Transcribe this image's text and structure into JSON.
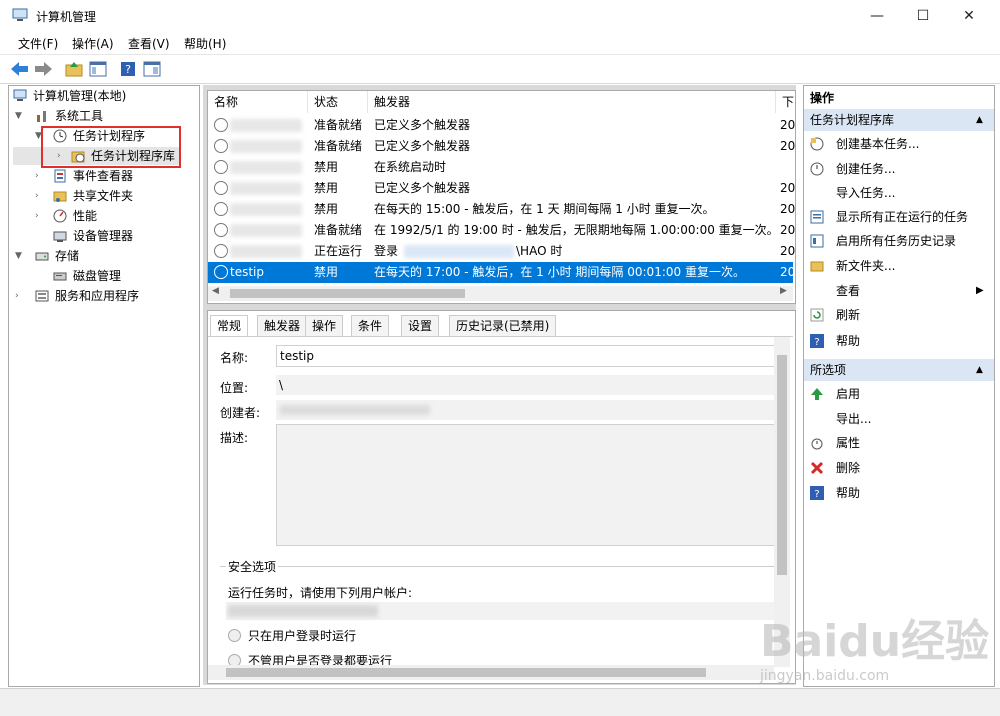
{
  "window": {
    "title": "计算机管理"
  },
  "menu": [
    "文件(F)",
    "操作(A)",
    "查看(V)",
    "帮助(H)"
  ],
  "tree": {
    "root": "计算机管理(本地)",
    "system_tools": "系统工具",
    "task_scheduler": "任务计划程序",
    "task_library": "任务计划程序库",
    "event_viewer": "事件查看器",
    "shared_folders": "共享文件夹",
    "performance": "性能",
    "device_manager": "设备管理器",
    "storage": "存储",
    "disk_management": "磁盘管理",
    "services_apps": "服务和应用程序"
  },
  "list": {
    "columns": [
      "名称",
      "状态",
      "触发器",
      "下"
    ],
    "rows": [
      {
        "name": "",
        "status": "准备就绪",
        "trigger": "已定义多个触发器",
        "next": "20"
      },
      {
        "name": "",
        "status": "准备就绪",
        "trigger": "已定义多个触发器",
        "next": "20"
      },
      {
        "name": "",
        "status": "禁用",
        "trigger": "在系统启动时",
        "next": ""
      },
      {
        "name": "",
        "status": "禁用",
        "trigger": "已定义多个触发器",
        "next": "20"
      },
      {
        "name": "",
        "status": "禁用",
        "trigger": "在每天的 15:00 - 触发后，在 1 天 期间每隔 1 小时 重复一次。",
        "next": "20"
      },
      {
        "name": "",
        "status": "准备就绪",
        "trigger": "在 1992/5/1 的 19:00 时 - 触发后，无限期地每隔 1.00:00:00 重复一次。",
        "next": "20"
      },
      {
        "name": "",
        "status": "正在运行",
        "trigger": "登录",
        "trigger_tail": "\\HAO 时",
        "next": "20"
      },
      {
        "name": "testip",
        "status": "禁用",
        "trigger": "在每天的 17:00 - 触发后，在 1 小时 期间每隔 00:01:00 重复一次。",
        "next": "20"
      }
    ]
  },
  "details": {
    "tabs": [
      "常规",
      "触发器",
      "操作",
      "条件",
      "设置",
      "历史记录(已禁用)"
    ],
    "name_label": "名称:",
    "name_value": "testip",
    "location_label": "位置:",
    "location_value": "\\",
    "author_label": "创建者:",
    "desc_label": "描述:",
    "security_title": "安全选项",
    "run_as_label": "运行任务时，请使用下列用户帐户:",
    "radio1": "只在用户登录时运行",
    "radio2": "不管用户是否登录都要运行"
  },
  "actions": {
    "header": "操作",
    "section1": "任务计划程序库",
    "items1": [
      "创建基本任务...",
      "创建任务...",
      "导入任务...",
      "显示所有正在运行的任务",
      "启用所有任务历史记录",
      "新文件夹...",
      "查看",
      "刷新",
      "帮助"
    ],
    "section2": "所选项",
    "items2": [
      "启用",
      "导出...",
      "属性",
      "删除",
      "帮助"
    ]
  },
  "watermark": {
    "text": "Baidu经验",
    "sub": "jingyan.baidu.com"
  }
}
